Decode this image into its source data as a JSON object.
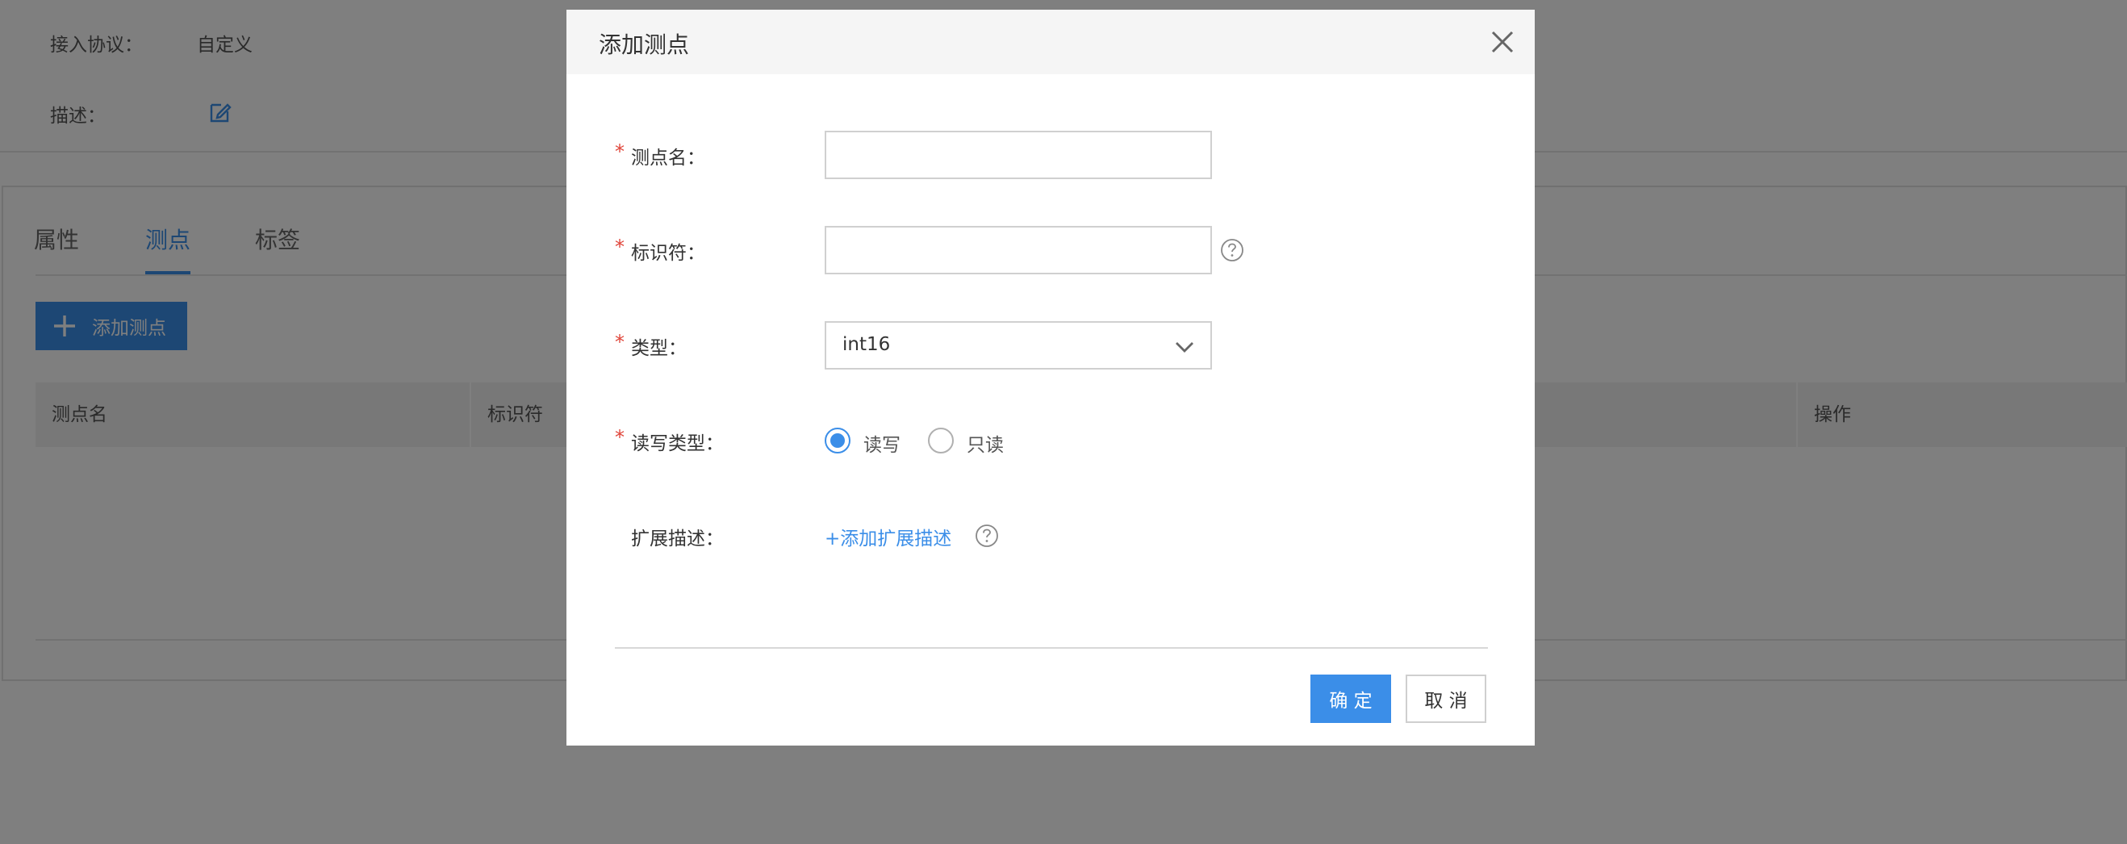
{
  "background": {
    "info": {
      "protocol_label": "接入协议：",
      "protocol_value": "自定义",
      "description_label": "描述："
    },
    "tabs": [
      {
        "label": "属性"
      },
      {
        "label": "测点",
        "active": true
      },
      {
        "label": "标签"
      }
    ],
    "add_button_label": "添加测点",
    "table_columns": [
      "测点名",
      "标识符",
      "操作"
    ]
  },
  "modal": {
    "title": "添加测点",
    "fields": {
      "name": {
        "label": "测点名：",
        "value": "",
        "required": true
      },
      "identifier": {
        "label": "标识符：",
        "value": "",
        "required": true
      },
      "type": {
        "label": "类型：",
        "selected": "int16",
        "required": true
      },
      "rw_type": {
        "label": "读写类型：",
        "required": true,
        "options": [
          "读写",
          "只读"
        ],
        "selected": "读写"
      },
      "ext_desc": {
        "label": "扩展描述：",
        "link_label": "+添加扩展描述"
      }
    },
    "required_mark": "*",
    "ok_label": "确 定",
    "cancel_label": "取 消"
  },
  "colors": {
    "accent": "#3b8ee8",
    "required": "#e0453a",
    "overlay": "rgba(0,0,0,0.5)"
  },
  "icons": [
    "edit-icon",
    "plus-icon",
    "close-icon",
    "help-icon",
    "chevron-down-icon"
  ]
}
